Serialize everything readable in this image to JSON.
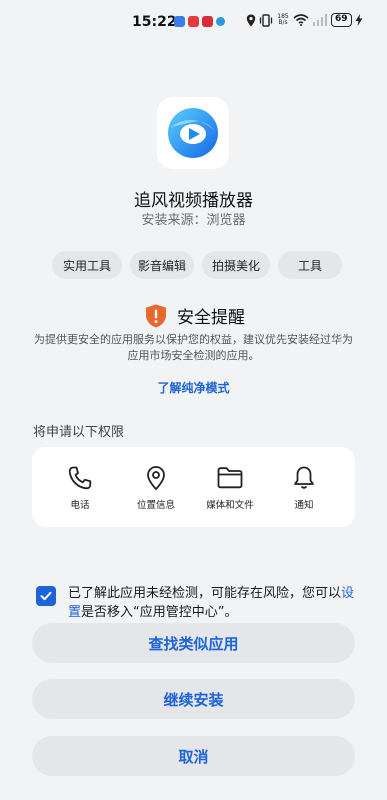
{
  "status_bar": {
    "time": "15:22",
    "net_speed_value": "185",
    "net_speed_unit": "B/s",
    "battery": "69",
    "notification_icons": [
      "blue-app-icon",
      "red-app-icon",
      "red-app-icon",
      "cyan-app-icon"
    ],
    "system_icons": [
      "location-icon",
      "vibrate-icon",
      "wifi-icon",
      "signal-icon",
      "battery-icon",
      "charging-icon"
    ]
  },
  "app": {
    "name": "追风视频播放器",
    "source_label": "安装来源：",
    "source_value": "浏览器",
    "icon": "video-player-app-icon",
    "tags": [
      "实用工具",
      "影音编辑",
      "拍摄美化",
      "工具"
    ]
  },
  "security": {
    "title": "安全提醒",
    "description": "为提供更安全的应用服务以保护您的权益，建议优先安装经过华为应用市场安全检测的应用。",
    "learn_more": "了解纯净模式",
    "icon": "shield-warning-icon",
    "accent_color": "#e8672a"
  },
  "permissions": {
    "heading": "将申请以下权限",
    "items": [
      {
        "label": "电话",
        "icon": "phone-icon"
      },
      {
        "label": "位置信息",
        "icon": "location-pin-icon"
      },
      {
        "label": "媒体和文件",
        "icon": "folder-icon"
      },
      {
        "label": "通知",
        "icon": "bell-icon"
      }
    ]
  },
  "consent": {
    "checked": true,
    "text_before": "已了解此应用未经检测，可能存在风险，您可以",
    "link": "设置",
    "text_after": "是否移入“应用管控中心”。"
  },
  "buttons": {
    "find_similar": "查找类似应用",
    "continue_install": "继续安装",
    "cancel": "取消"
  },
  "colors": {
    "accent": "#1e64d8",
    "background": "#f1f3f5",
    "button_bg": "#e4e6ea"
  }
}
